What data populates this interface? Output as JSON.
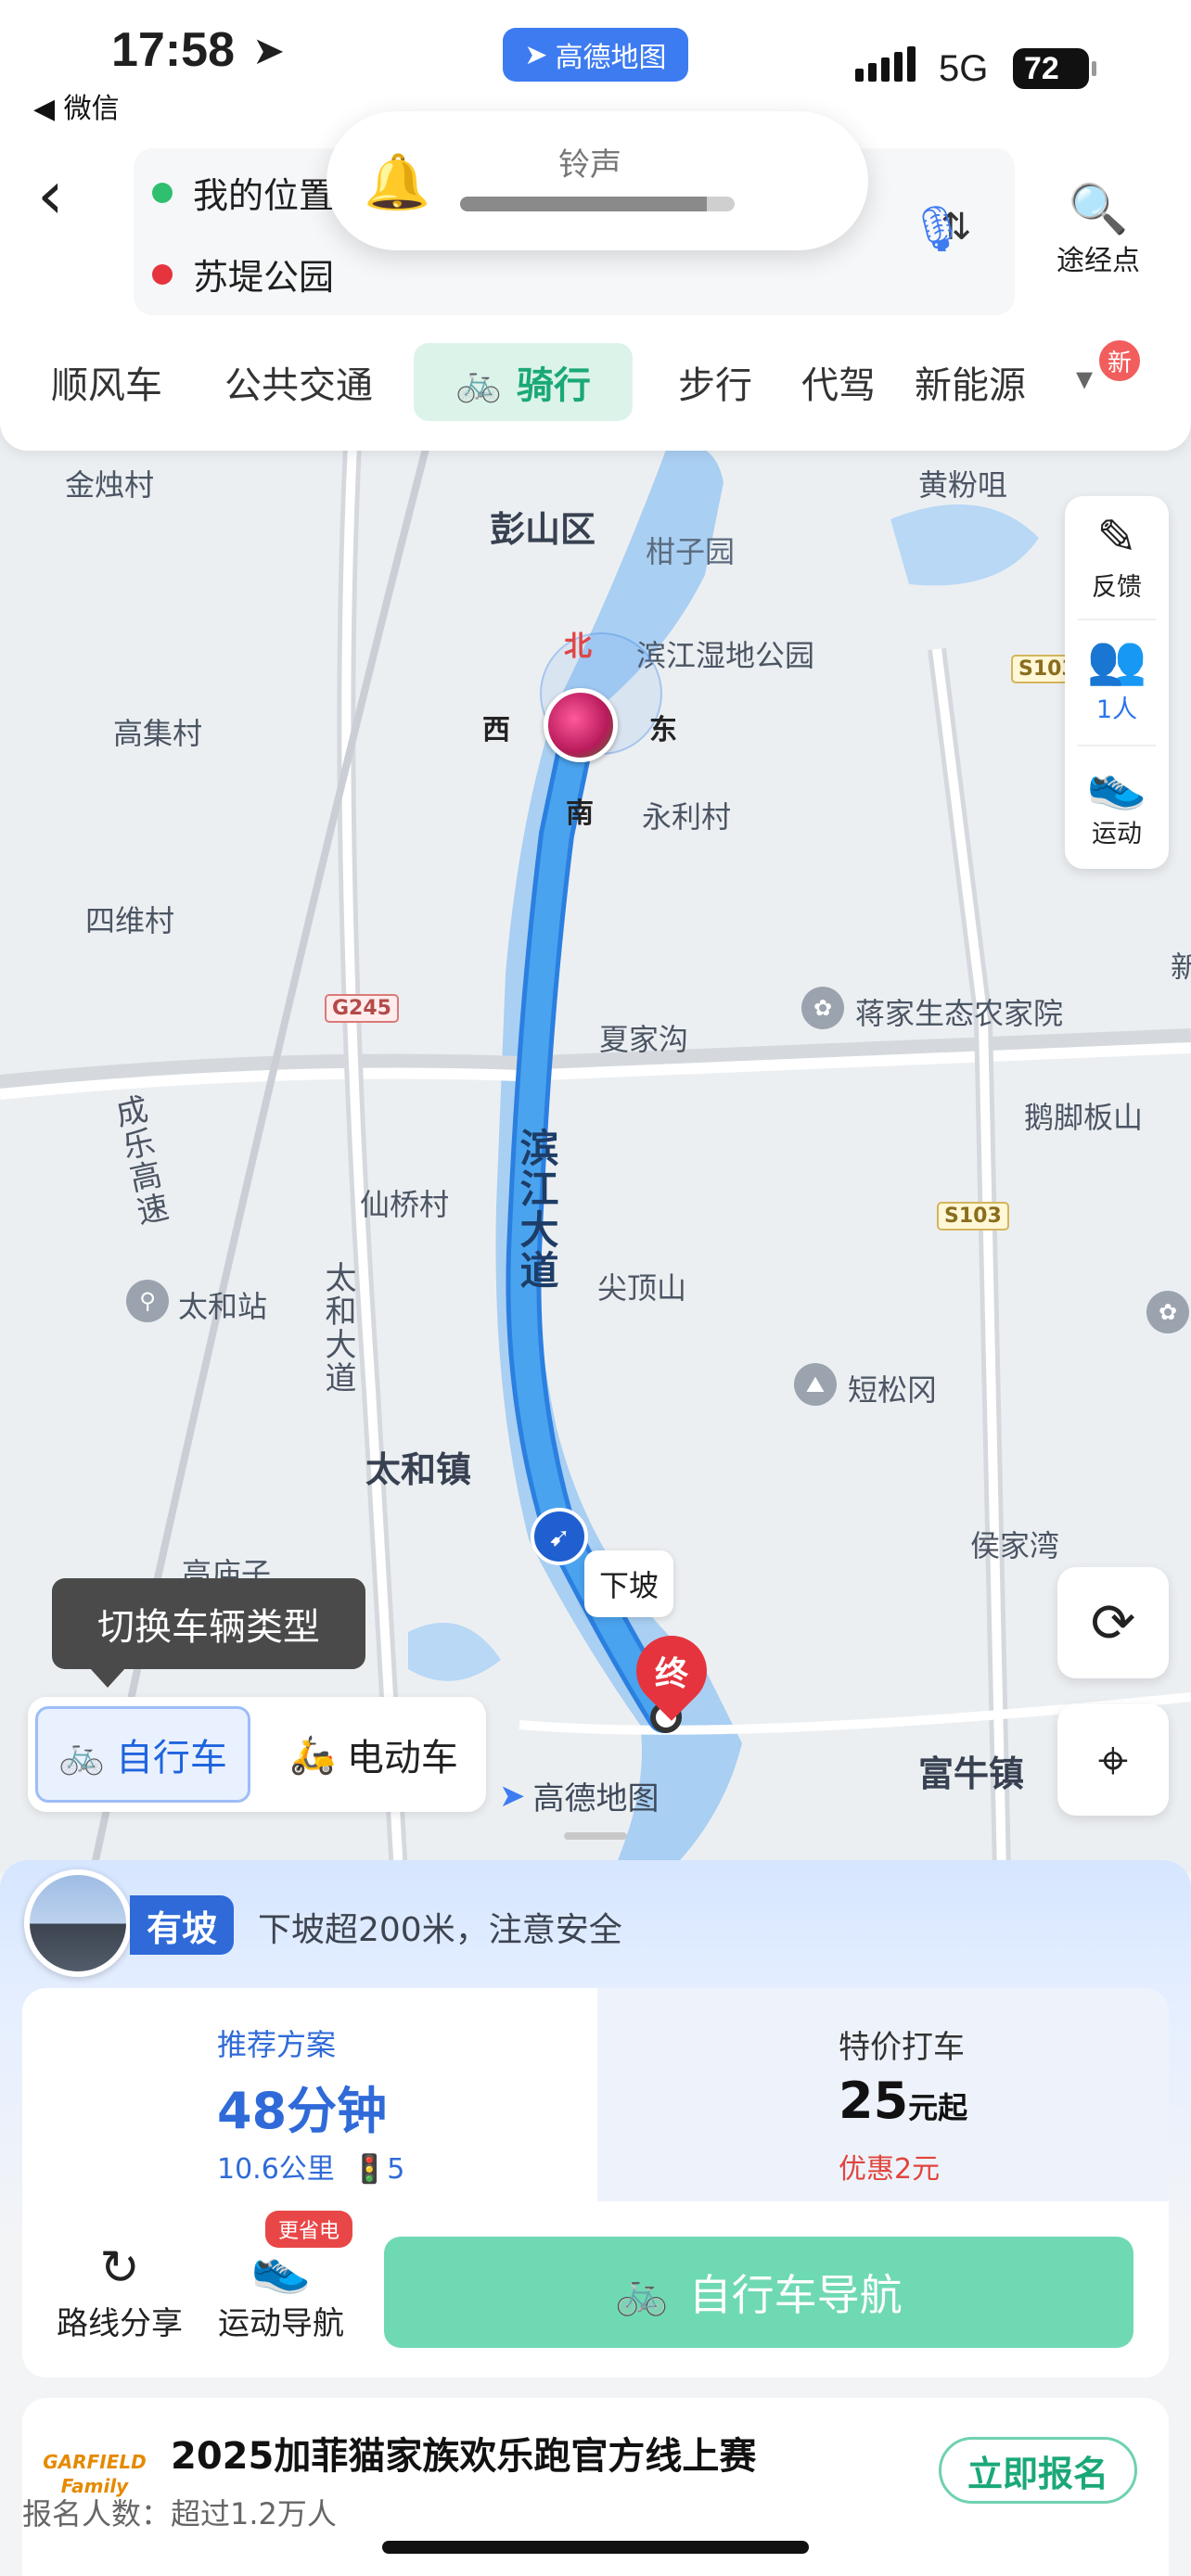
{
  "status": {
    "time": "17:58",
    "back_app": "◀ 微信",
    "app_pill": "高德地图",
    "network": "5G",
    "battery": "72"
  },
  "ringer": {
    "title": "铃声",
    "level": 0.9
  },
  "route": {
    "origin": "我的位置",
    "destination": "苏堤公园",
    "waypoint_label": "途经点"
  },
  "modes": {
    "items": [
      "顺风车",
      "公共交通",
      "骑行",
      "步行",
      "代驾",
      "新能源"
    ],
    "active": "骑行",
    "new_badge": "新"
  },
  "map": {
    "labels": [
      "金烛村",
      "彭山区",
      "柑子园",
      "黄粉咀",
      "滨江湿地公园",
      "高集村",
      "永利村",
      "四维村",
      "夏家沟",
      "蒋家生态农家院",
      "鹅脚板山",
      "仙桥村",
      "尖顶山",
      "太和站",
      "短松冈",
      "太和镇",
      "高庙子",
      "侯家湾",
      "富牛镇",
      "新"
    ],
    "highway_vertical": "成乐高速",
    "road_vertical": "太和大道",
    "route_name": "滨江大道",
    "shields": [
      "S103",
      "G245",
      "S103"
    ],
    "compass": {
      "north": "北",
      "south": "南",
      "east": "东",
      "west": "西"
    },
    "downhill_tag": "下坡",
    "end_marker": "终",
    "logo_text": "高德地图"
  },
  "tools": {
    "feedback": "反馈",
    "people": "1人",
    "sport": "运动"
  },
  "vehicle": {
    "tooltip": "切换车辆类型",
    "options": [
      "自行车",
      "电动车"
    ],
    "active": "自行车"
  },
  "slope": {
    "tag": "有坡",
    "text": "下坡超200米，注意安全"
  },
  "plan": {
    "title": "推荐方案",
    "duration": "48分钟",
    "distance": "10.6公里",
    "lights": "5",
    "alt_title": "特价打车",
    "alt_price": "25",
    "alt_price_unit": "元起",
    "alt_discount": "优惠2元"
  },
  "actions": {
    "share": "路线分享",
    "sport_nav": "运动导航",
    "save_badge": "更省电",
    "nav_button": "自行车导航"
  },
  "ad": {
    "logo": "GARFIELD Family",
    "title": "2025加菲猫家族欢乐跑官方线上赛",
    "subtitle": "报名人数：超过1.2万人",
    "button": "立即报名"
  },
  "colors": {
    "route": "#4aa3ee",
    "accent_green": "#1aa877",
    "brand_blue": "#2f6ad8",
    "end_red": "#e5343e"
  }
}
